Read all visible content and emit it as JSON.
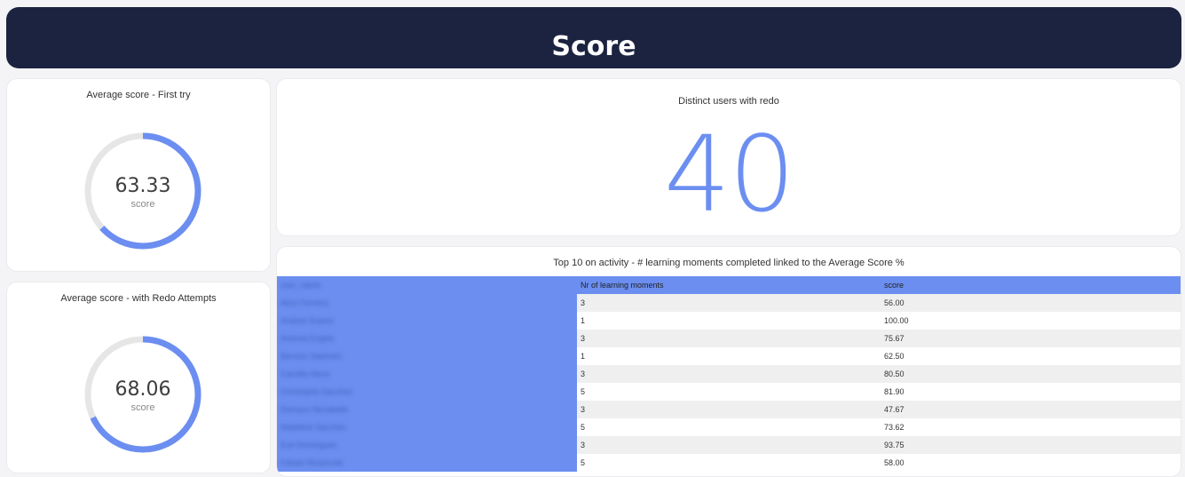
{
  "header": {
    "title": "Score"
  },
  "gauge_first": {
    "title": "Average score - First try",
    "value": "63.33",
    "unit": "score",
    "fraction": 0.6333,
    "color": "#6b8ef0"
  },
  "gauge_redo": {
    "title": "Average score - with Redo Attempts",
    "value": "68.06",
    "unit": "score",
    "fraction": 0.6806,
    "color": "#6b8ef0"
  },
  "kpi": {
    "title": "Distinct users with redo",
    "value": "40"
  },
  "table": {
    "title": "Top 10 on activity - # learning moments completed linked to the Average Score %",
    "columns": [
      "user_name",
      "Nr of learning moments",
      "score"
    ],
    "rows": [
      {
        "name": "Alice Ferreira",
        "moments": "3",
        "score": "56.00"
      },
      {
        "name": "Andrea Suarez",
        "moments": "1",
        "score": "100.00"
      },
      {
        "name": "Antonia Engels",
        "moments": "3",
        "score": "75.67"
      },
      {
        "name": "Bernice Saarinen",
        "moments": "1",
        "score": "62.50"
      },
      {
        "name": "Camilla Herra",
        "moments": "3",
        "score": "80.50"
      },
      {
        "name": "Christophe Sanchez",
        "moments": "5",
        "score": "81.90"
      },
      {
        "name": "Damyon Nezabelle",
        "moments": "3",
        "score": "47.67"
      },
      {
        "name": "Madeline Sanchez",
        "moments": "5",
        "score": "73.62"
      },
      {
        "name": "Eve Dominguez",
        "moments": "3",
        "score": "93.75"
      },
      {
        "name": "Fabian Rosenvelt",
        "moments": "5",
        "score": "58.00"
      }
    ]
  }
}
